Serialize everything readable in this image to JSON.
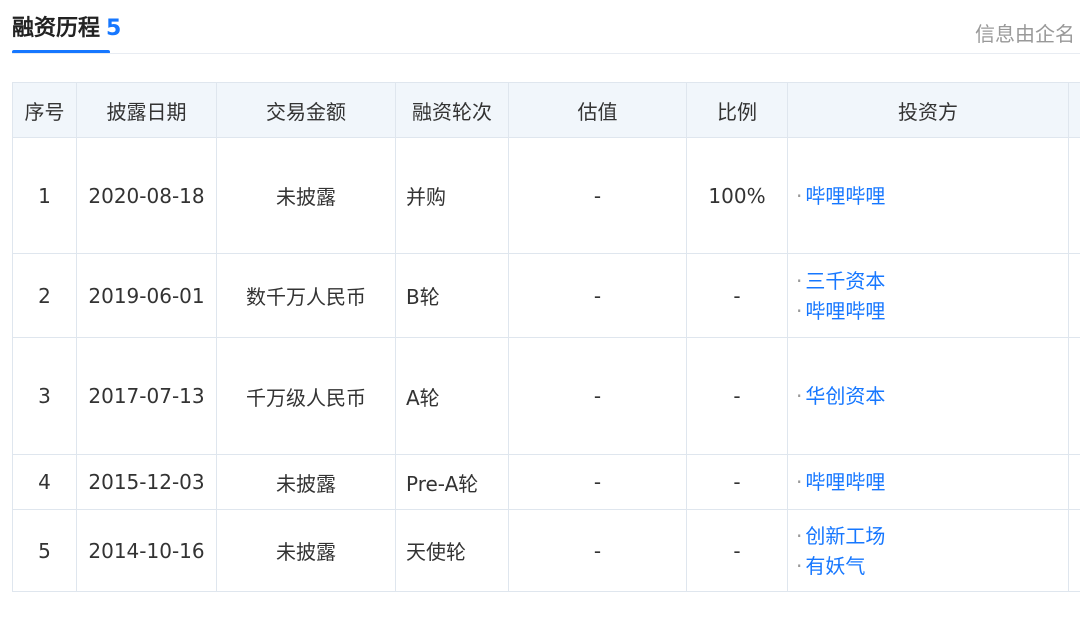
{
  "header": {
    "title": "融资历程",
    "count": "5",
    "source_note": "信息由企名"
  },
  "table": {
    "columns": [
      "序号",
      "披露日期",
      "交易金额",
      "融资轮次",
      "估值",
      "比例",
      "投资方",
      ""
    ],
    "rows": [
      {
        "index": "1",
        "date": "2020-08-18",
        "amount": "未披露",
        "round": "并购",
        "valuation": "-",
        "ratio": "100%",
        "investors": [
          "哔哩哔哩"
        ]
      },
      {
        "index": "2",
        "date": "2019-06-01",
        "amount": "数千万人民币",
        "round": "B轮",
        "valuation": "-",
        "ratio": "-",
        "investors": [
          "三千资本",
          "哔哩哔哩"
        ]
      },
      {
        "index": "3",
        "date": "2017-07-13",
        "amount": "千万级人民币",
        "round": "A轮",
        "valuation": "-",
        "ratio": "-",
        "investors": [
          "华创资本"
        ]
      },
      {
        "index": "4",
        "date": "2015-12-03",
        "amount": "未披露",
        "round": "Pre-A轮",
        "valuation": "-",
        "ratio": "-",
        "investors": [
          "哔哩哔哩"
        ]
      },
      {
        "index": "5",
        "date": "2014-10-16",
        "amount": "未披露",
        "round": "天使轮",
        "valuation": "-",
        "ratio": "-",
        "investors": [
          "创新工场",
          "有妖气"
        ]
      }
    ]
  }
}
